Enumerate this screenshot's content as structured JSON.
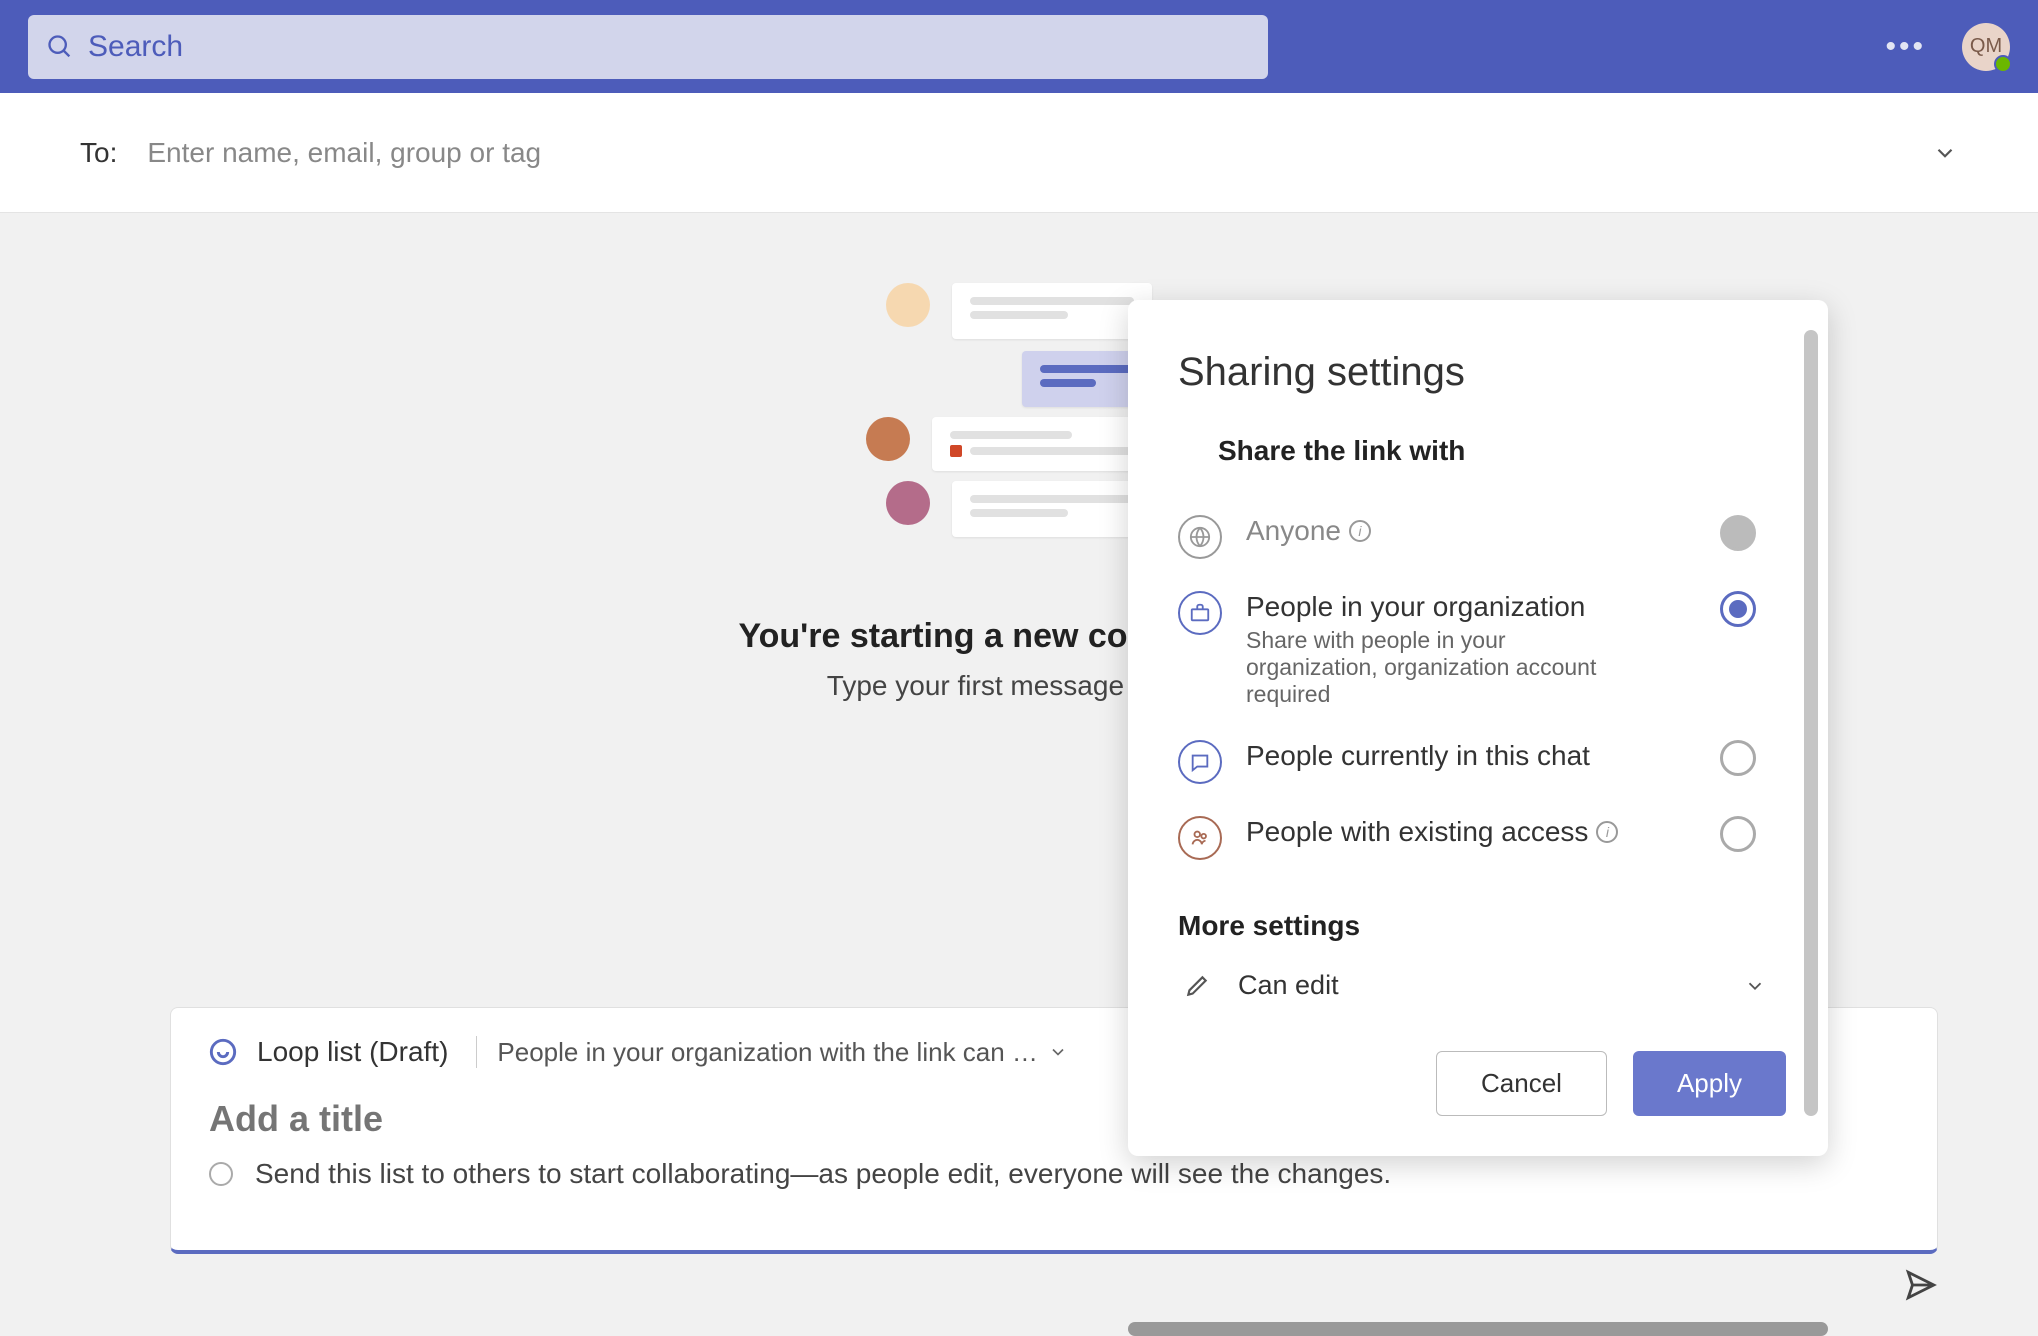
{
  "top": {
    "search_placeholder": "Search",
    "avatar_initials": "QM"
  },
  "to": {
    "label": "To:",
    "placeholder": "Enter name, email, group or tag"
  },
  "empty": {
    "title": "You're starting a new conversation",
    "subtitle": "Type your first message below."
  },
  "loop": {
    "badge": "Loop list (Draft)",
    "perm_summary": "People in your organization with the link can …",
    "title_placeholder": "Add a title",
    "item_hint": "Send this list to others to start collaborating—as people edit, everyone will see the changes."
  },
  "sharing": {
    "title": "Sharing settings",
    "share_with_label": "Share the link with",
    "options": {
      "anyone": {
        "label": "Anyone"
      },
      "org": {
        "label": "People in your organization",
        "desc": "Share with people in your organization, organization account required"
      },
      "chat": {
        "label": "People currently in this chat"
      },
      "existing": {
        "label": "People with existing access"
      }
    },
    "more_label": "More settings",
    "permission": "Can edit",
    "cancel": "Cancel",
    "apply": "Apply"
  }
}
